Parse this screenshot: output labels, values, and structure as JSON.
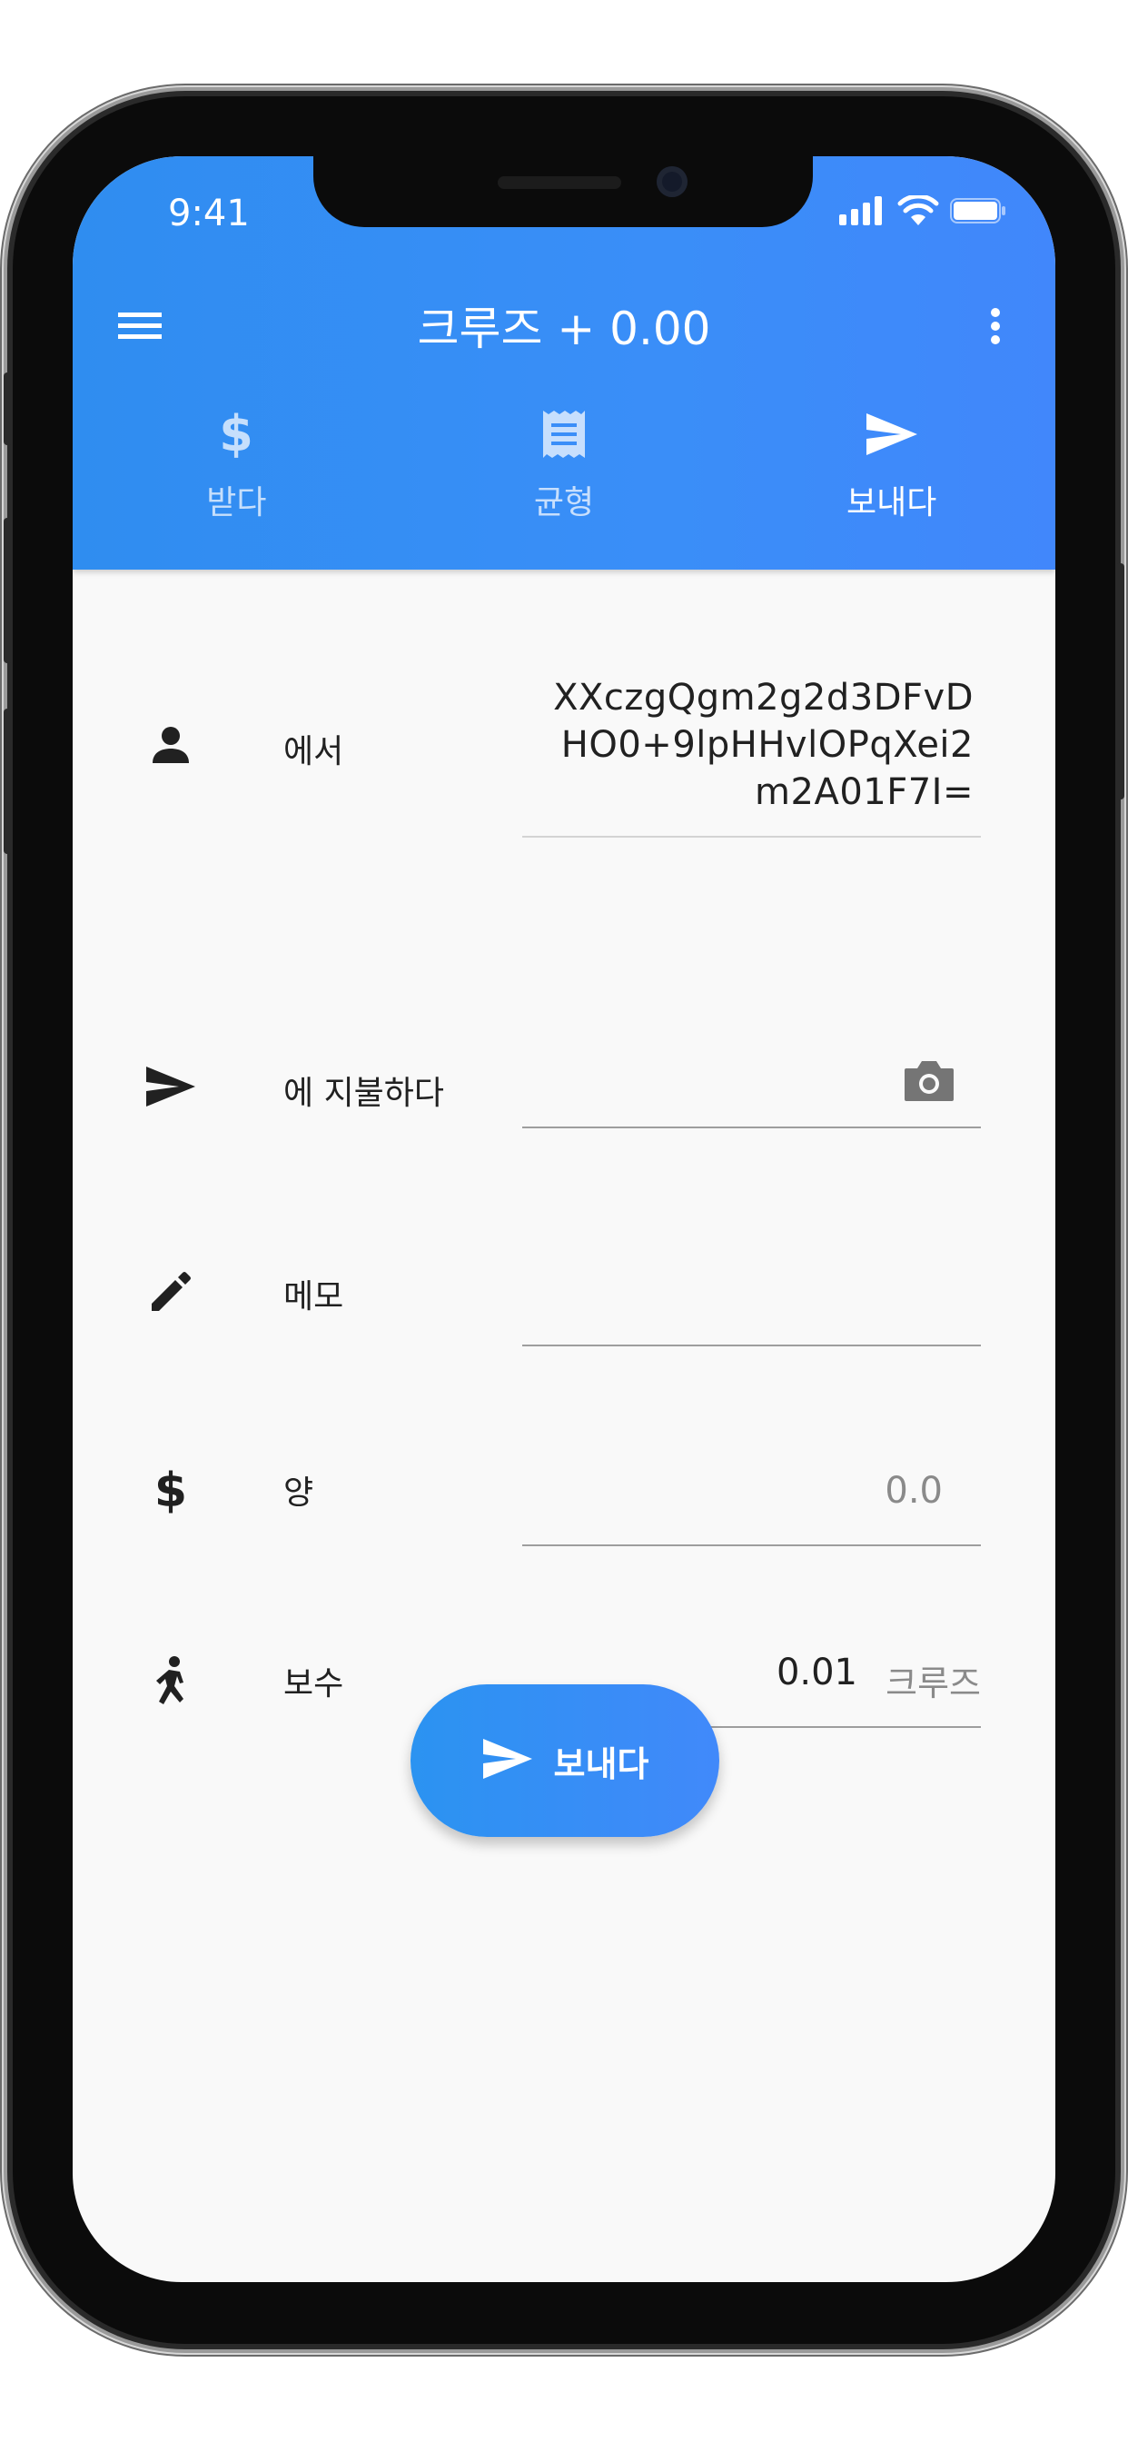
{
  "status_bar": {
    "time": "9:41"
  },
  "app_bar": {
    "title": "크루즈 + 0.00"
  },
  "tabs": [
    {
      "label": "받다",
      "icon": "dollar-icon",
      "active": false
    },
    {
      "label": "균형",
      "icon": "receipt-icon",
      "active": false
    },
    {
      "label": "보내다",
      "icon": "send-icon",
      "active": true
    }
  ],
  "form": {
    "from": {
      "label": "에서",
      "value_lines": [
        "XXczgQgm2g2d3DFvD",
        "HO0+9lpHHvlOPqXei2",
        "m2A01F7I="
      ]
    },
    "pay_to": {
      "label": "에 지불하다",
      "value": ""
    },
    "memo": {
      "label": "메모",
      "value": ""
    },
    "amount": {
      "label": "양",
      "placeholder": "0.0"
    },
    "fee": {
      "label": "보수",
      "value": "0.01",
      "unit": "크루즈"
    }
  },
  "send_button": {
    "label": "보내다"
  },
  "colors": {
    "primary": "#3a8ef8",
    "text": "#212121",
    "hint": "#8a8a8a"
  }
}
